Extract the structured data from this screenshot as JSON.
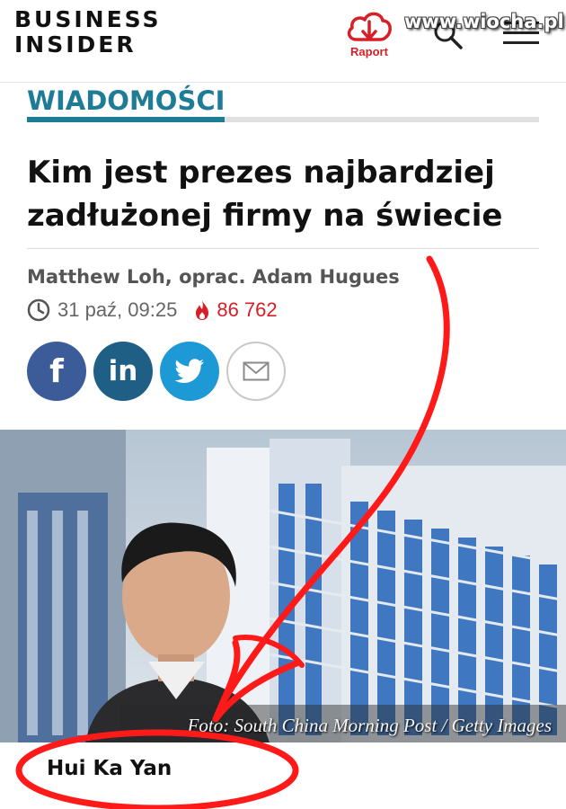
{
  "header": {
    "logo_line1": "BUSINESS",
    "logo_line2": "INSIDER",
    "report_label": "Raport",
    "watermark": "www.wiocha.pl"
  },
  "section": {
    "label": "WIADOMOŚCI"
  },
  "article": {
    "title": "Kim jest prezes najbardziej zadłużonej firmy na świecie",
    "author": "Matthew Loh, oprac. Adam Hugues",
    "date": "31 paź, 09:25",
    "views": "86 762"
  },
  "share": {
    "facebook_label": "f",
    "linkedin_label": "in"
  },
  "image": {
    "credit": "Foto: South China Morning Post / Getty Images",
    "caption": "Hui Ka Yan"
  },
  "colors": {
    "accent": "#1e7c96",
    "alert": "#d61f26",
    "annotation": "#ff1a1a"
  },
  "icons": [
    "raport-cloud-icon",
    "search-icon",
    "menu-icon",
    "clock-icon",
    "flame-icon",
    "facebook-icon",
    "linkedin-icon",
    "twitter-icon",
    "mail-icon"
  ]
}
